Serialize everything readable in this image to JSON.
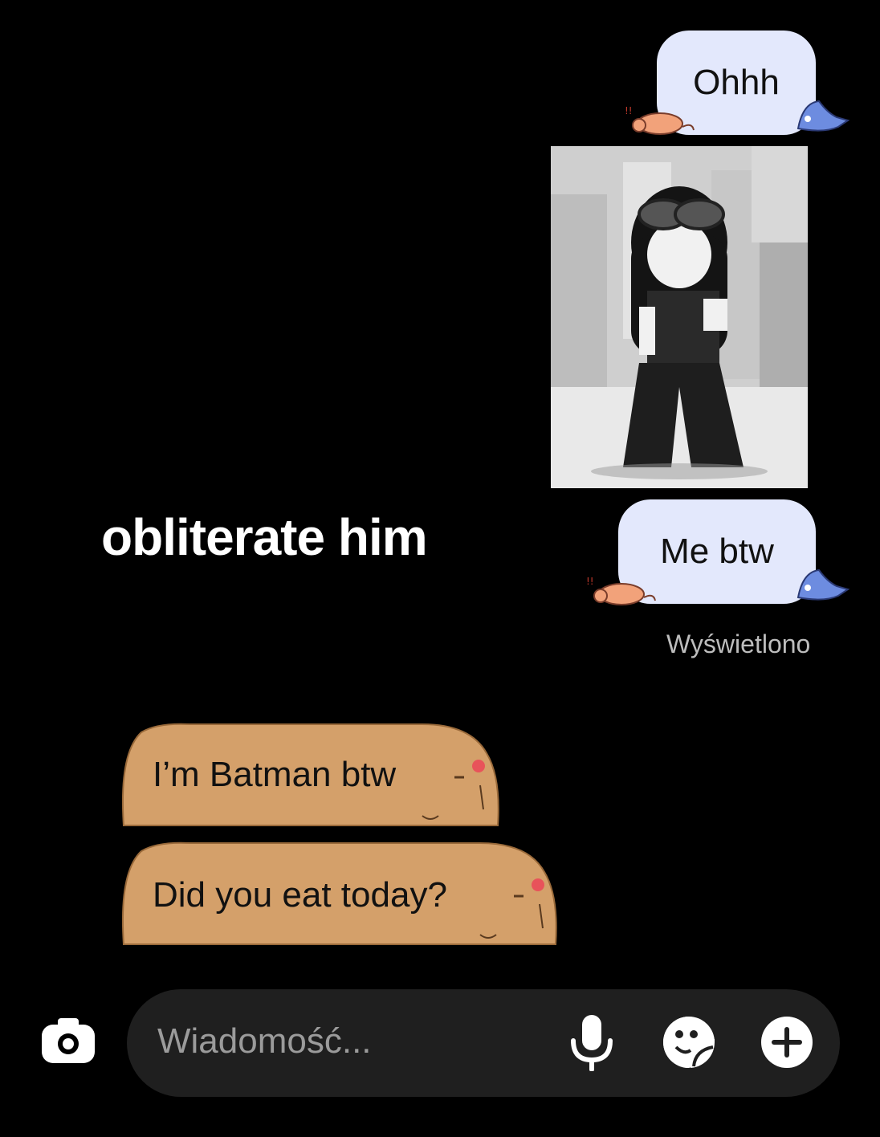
{
  "messages": {
    "sent_1": "Ohhh",
    "sent_2": "Me btw",
    "caption": "obliterate him",
    "seen_status": "Wyświetlono",
    "received_1": "I’m Batman btw",
    "received_2": "Did you eat today?"
  },
  "composer": {
    "placeholder": "Wiadomość..."
  },
  "icons": {
    "camera": "camera-icon",
    "mic": "microphone-icon",
    "sticker": "sticker-icon",
    "plus": "plus-icon"
  },
  "colors": {
    "background": "#000000",
    "sent_bubble": "#e3e8fc",
    "received_bubble": "#d4a06a",
    "composer": "#1f1f1f",
    "seen_text": "#bdbdbd"
  }
}
